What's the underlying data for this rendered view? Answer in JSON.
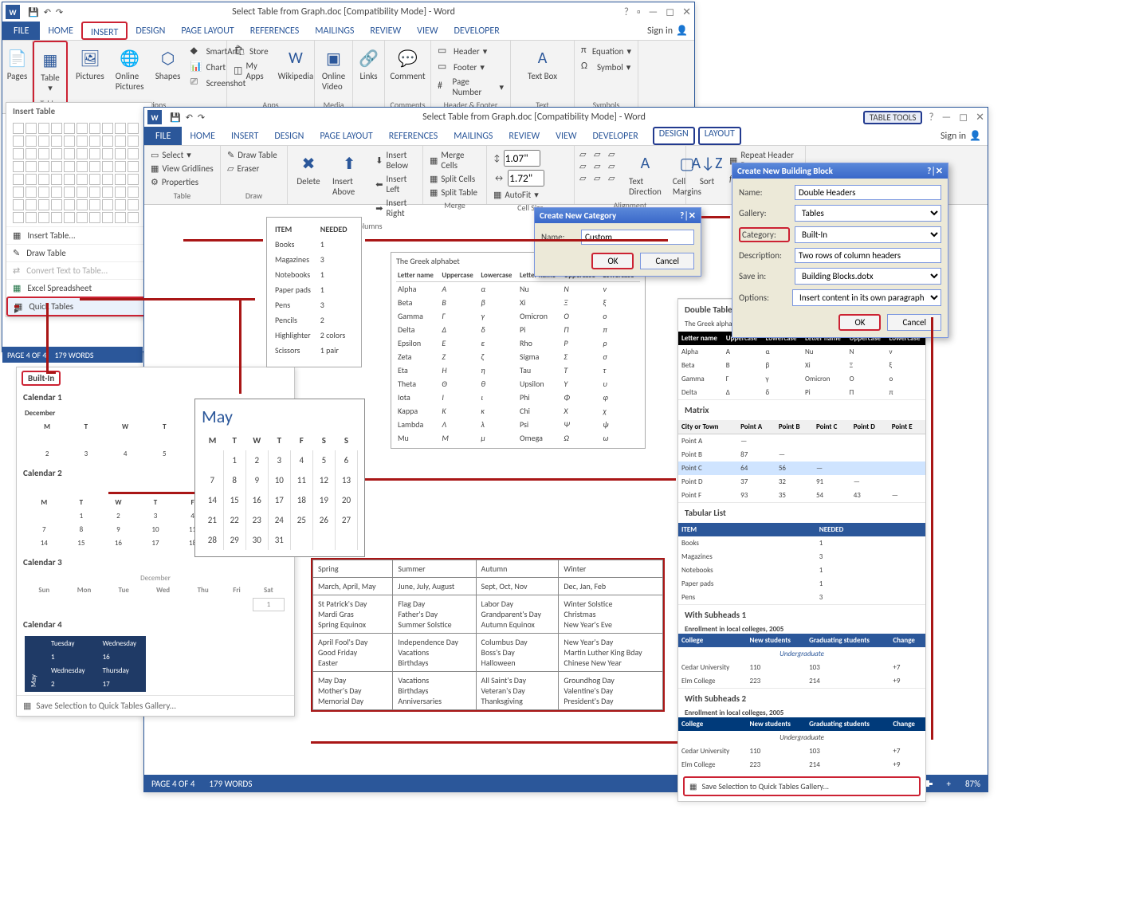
{
  "win1": {
    "title": "Select Table from Graph.doc [Compatibility Mode] - Word",
    "tabs": [
      "FILE",
      "HOME",
      "INSERT",
      "DESIGN",
      "PAGE LAYOUT",
      "REFERENCES",
      "MAILINGS",
      "REVIEW",
      "VIEW",
      "DEVELOPER"
    ],
    "signin": "Sign in",
    "ribbon": {
      "pages": "Pages",
      "table": "Table",
      "tables_group": "Tables",
      "pictures": "Pictures",
      "online_pictures": "Online Pictures",
      "shapes": "Shapes",
      "smartart": "SmartArt",
      "chart": "Chart",
      "screenshot": "Screenshot",
      "illustrations_group": "Illustrations",
      "store": "Store",
      "myapps": "My Apps",
      "wikipedia": "Wikipedia",
      "apps_group": "Apps",
      "online_video": "Online Video",
      "media_group": "Media",
      "links": "Links",
      "comment": "Comment",
      "comments_group": "Comments",
      "header": "Header",
      "footer": "Footer",
      "page_number": "Page Number",
      "hf_group": "Header & Footer",
      "text_box": "Text Box",
      "text_group": "Text",
      "equation": "Equation",
      "symbol": "Symbol",
      "symbols_group": "Symbols"
    }
  },
  "insert_table_panel": {
    "title": "Insert Table",
    "items": [
      "Insert Table...",
      "Draw Table",
      "Convert Text to Table...",
      "Excel Spreadsheet",
      "Quick Tables"
    ]
  },
  "status1": {
    "page": "PAGE 4 OF 4",
    "words": "179 WORDS"
  },
  "qt": {
    "builtin": "Built-In",
    "cal1": "Calendar 1",
    "cal2": "Calendar 2",
    "cal3": "Calendar 3",
    "cal4": "Calendar 4",
    "december": "December",
    "may_label": "MAY",
    "days_short": [
      "M",
      "T",
      "W",
      "T",
      "F",
      "S",
      "S"
    ],
    "days_full": [
      "Sun",
      "Mon",
      "Tue",
      "Wed",
      "Thu",
      "Fri",
      "Sat"
    ],
    "cal4_rows": [
      [
        "Tuesday",
        "Wednesday"
      ],
      [
        "1",
        "16"
      ],
      [
        "Wednesday",
        "Thursday"
      ],
      [
        "2",
        "17"
      ]
    ],
    "save": "Save Selection to Quick Tables Gallery..."
  },
  "may": {
    "title": "May",
    "head": [
      "M",
      "T",
      "W",
      "T",
      "F",
      "S",
      "S"
    ],
    "rows": [
      [
        "",
        "1",
        "2",
        "3",
        "4",
        "5",
        "6"
      ],
      [
        "7",
        "8",
        "9",
        "10",
        "11",
        "12",
        "13"
      ],
      [
        "14",
        "15",
        "16",
        "17",
        "18",
        "19",
        "20"
      ],
      [
        "21",
        "22",
        "23",
        "24",
        "25",
        "26",
        "27"
      ],
      [
        "28",
        "29",
        "30",
        "31",
        "",
        "",
        ""
      ]
    ]
  },
  "items": {
    "head": [
      "ITEM",
      "NEEDED"
    ],
    "rows": [
      [
        "Books",
        "1"
      ],
      [
        "Magazines",
        "3"
      ],
      [
        "Notebooks",
        "1"
      ],
      [
        "Paper pads",
        "1"
      ],
      [
        "Pens",
        "3"
      ],
      [
        "Pencils",
        "2"
      ],
      [
        "Highlighter",
        "2 colors"
      ],
      [
        "Scissors",
        "1 pair"
      ]
    ]
  },
  "greek": {
    "title": "The Greek alphabet",
    "head": [
      "Letter name",
      "Uppercase",
      "Lowercase",
      "Letter name",
      "Uppercase",
      "Lowercase"
    ],
    "rows": [
      [
        "Alpha",
        "Α",
        "α",
        "Nu",
        "Ν",
        "ν"
      ],
      [
        "Beta",
        "Β",
        "β",
        "Xi",
        "Ξ",
        "ξ"
      ],
      [
        "Gamma",
        "Γ",
        "γ",
        "Omicron",
        "Ο",
        "ο"
      ],
      [
        "Delta",
        "Δ",
        "δ",
        "Pi",
        "Π",
        "π"
      ],
      [
        "Epsilon",
        "Ε",
        "ε",
        "Rho",
        "Ρ",
        "ρ"
      ],
      [
        "Zeta",
        "Ζ",
        "ζ",
        "Sigma",
        "Σ",
        "σ"
      ],
      [
        "Eta",
        "Η",
        "η",
        "Tau",
        "Τ",
        "τ"
      ],
      [
        "Theta",
        "Θ",
        "θ",
        "Upsilon",
        "Υ",
        "υ"
      ],
      [
        "Iota",
        "Ι",
        "ι",
        "Phi",
        "Φ",
        "φ"
      ],
      [
        "Kappa",
        "Κ",
        "κ",
        "Chi",
        "Χ",
        "χ"
      ],
      [
        "Lambda",
        "Λ",
        "λ",
        "Psi",
        "Ψ",
        "ψ"
      ],
      [
        "Mu",
        "Μ",
        "μ",
        "Omega",
        "Ω",
        "ω"
      ]
    ]
  },
  "seasons": {
    "rows": [
      [
        "Spring",
        "Summer",
        "Autumn",
        "Winter"
      ],
      [
        "March, April, May",
        "June, July, August",
        "Sept, Oct, Nov",
        "Dec, Jan, Feb"
      ],
      [
        "St Patrick's Day\nMardi Gras\nSpring Equinox",
        "Flag Day\nFather's Day\nSummer Solstice",
        "Labor Day\nGrandparent's Day\nAutumn Equinox",
        "Winter Solstice\nChristmas\nNew Year's Eve"
      ],
      [
        "April Fool's Day\nGood Friday\nEaster",
        "Independence Day\nVacations\nBirthdays",
        "Columbus Day\nBoss's Day\nHalloween",
        "New Year's Day\nMartin Luther King Bday\nChinese New Year"
      ],
      [
        "May Day\nMother's Day\nMemorial Day",
        "Vacations\nBirthdays\nAnniversaries",
        "All Saint's Day\nVeteran's Day\nThanksgiving",
        "Groundhog Day\nValentine's Day\nPresident's Day"
      ]
    ]
  },
  "win2": {
    "title": "Select Table from Graph.doc [Compatibility Mode] - Word",
    "tabs": [
      "FILE",
      "HOME",
      "INSERT",
      "DESIGN",
      "PAGE LAYOUT",
      "REFERENCES",
      "MAILINGS",
      "REVIEW",
      "VIEW",
      "DEVELOPER"
    ],
    "ctx_tools": "TABLE TOOLS",
    "ctx_tabs": [
      "DESIGN",
      "LAYOUT"
    ],
    "signin": "Sign in",
    "ribbon": {
      "select": "Select",
      "view_gridlines": "View Gridlines",
      "properties": "Properties",
      "table_group": "Table",
      "draw_table": "Draw Table",
      "eraser": "Eraser",
      "draw_group": "Draw",
      "delete": "Delete",
      "insert_above": "Insert Above",
      "insert_below": "Insert Below",
      "insert_left": "Insert Left",
      "insert_right": "Insert Right",
      "rc_group": "Rows & Columns",
      "merge_cells": "Merge Cells",
      "split_cells": "Split Cells",
      "split_table": "Split Table",
      "merge_group": "Merge",
      "h": "1.07\"",
      "w": "1.72\"",
      "autofit": "AutoFit",
      "cs_group": "Cell Size",
      "text_dir": "Text Direction",
      "cell_margins": "Cell Margins",
      "align_group": "Alignment",
      "sort": "Sort",
      "repeat": "Repeat Header Rows"
    }
  },
  "cat_dlg": {
    "title": "Create New Category",
    "name_lbl": "Name:",
    "name_val": "Custom",
    "ok": "OK",
    "cancel": "Cancel"
  },
  "bb_dlg": {
    "title": "Create New Building Block",
    "name_lbl": "Name:",
    "name_val": "Double Headers",
    "gallery_lbl": "Gallery:",
    "gallery_val": "Tables",
    "category_lbl": "Category:",
    "category_val": "Built-In",
    "desc_lbl": "Description:",
    "desc_val": "Two rows of column headers",
    "savein_lbl": "Save in:",
    "savein_val": "Building Blocks.dotx",
    "options_lbl": "Options:",
    "options_val": "Insert content in its own paragraph",
    "ok": "OK",
    "cancel": "Cancel"
  },
  "right": {
    "double_table": "Double Table",
    "greek_caption": "The Greek alphabet",
    "greek_head": [
      "Letter name",
      "Uppercase",
      "Lowercase",
      "Letter name",
      "Uppercase",
      "Lowercase"
    ],
    "greek_rows": [
      [
        "Alpha",
        "Α",
        "α",
        "Nu",
        "Ν",
        "ν"
      ],
      [
        "Beta",
        "Β",
        "β",
        "Xi",
        "Ξ",
        "ξ"
      ],
      [
        "Gamma",
        "Γ",
        "γ",
        "Omicron",
        "Ο",
        "ο"
      ],
      [
        "Delta",
        "Δ",
        "δ",
        "Pi",
        "Π",
        "π"
      ]
    ],
    "matrix": "Matrix",
    "matrix_head": [
      "City or Town",
      "Point A",
      "Point B",
      "Point C",
      "Point D",
      "Point E"
    ],
    "matrix_rows": [
      [
        "Point A",
        "—",
        "",
        "",
        "",
        ""
      ],
      [
        "Point B",
        "87",
        "—",
        "",
        "",
        ""
      ],
      [
        "Point C",
        "64",
        "56",
        "—",
        "",
        ""
      ],
      [
        "Point D",
        "37",
        "32",
        "91",
        "—",
        ""
      ],
      [
        "Point F",
        "93",
        "35",
        "54",
        "43",
        "—"
      ]
    ],
    "tabular": "Tabular List",
    "tab_head": [
      "ITEM",
      "NEEDED"
    ],
    "tab_rows": [
      [
        "Books",
        "1"
      ],
      [
        "Magazines",
        "3"
      ],
      [
        "Notebooks",
        "1"
      ],
      [
        "Paper pads",
        "1"
      ],
      [
        "Pens",
        "3"
      ]
    ],
    "ws1": "With Subheads 1",
    "enroll": "Enrollment in local colleges, 2005",
    "ws_head": [
      "College",
      "New students",
      "Graduating students",
      "Change"
    ],
    "undergrad": "Undergraduate",
    "ws_rows": [
      [
        "Cedar University",
        "110",
        "103",
        "+7"
      ],
      [
        "Elm College",
        "223",
        "214",
        "+9"
      ]
    ],
    "ws2": "With Subheads 2",
    "save": "Save Selection to Quick Tables Gallery..."
  },
  "status2": {
    "page": "PAGE 4 OF 4",
    "words": "179 WORDS",
    "zoom": "87%"
  }
}
